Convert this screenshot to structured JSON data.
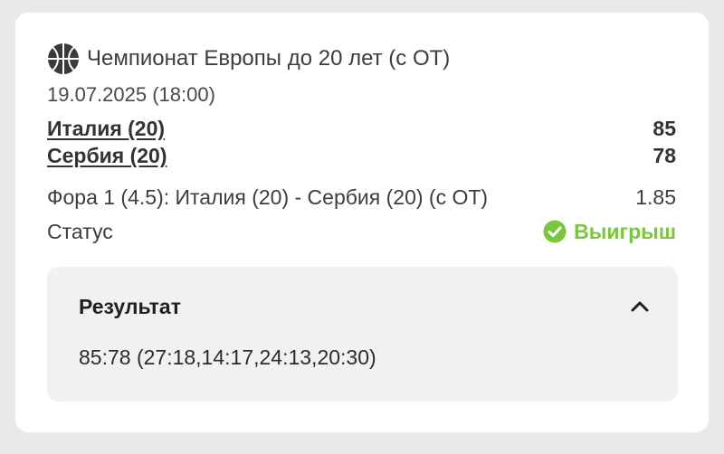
{
  "event": {
    "league_icon": "basketball-icon",
    "league": "Чемпионат Европы до 20 лет (с ОТ)",
    "datetime": "19.07.2025 (18:00)",
    "team1": {
      "name": "Италия (20)",
      "score": "85"
    },
    "team2": {
      "name": "Сербия (20)",
      "score": "78"
    }
  },
  "bet": {
    "label": "Фора 1 (4.5): Италия (20) - Сербия (20) (с ОТ)",
    "odds": "1.85"
  },
  "status": {
    "label": "Статус",
    "value": "Выигрыш",
    "icon": "check-circle-icon",
    "color": "#7cc63e"
  },
  "result": {
    "title": "Результат",
    "toggle_icon": "chevron-up-icon",
    "value": "85:78 (27:18,14:17,24:13,20:30)"
  },
  "colors": {
    "background": "#e9e9e9",
    "card": "#ffffff",
    "result_panel": "#f1f1f1",
    "win": "#7cc63e"
  }
}
